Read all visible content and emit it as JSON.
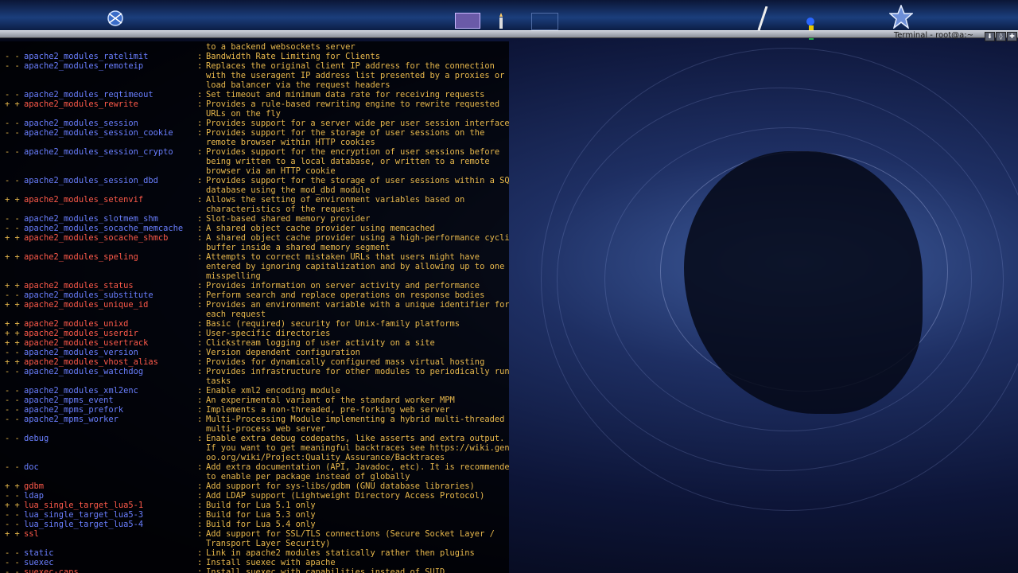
{
  "desktop": {
    "terminal_title": "Terminal - root@a:~",
    "window_buttons": [
      "⬇",
      "◊",
      "✚"
    ]
  },
  "terminal": {
    "lines": [
      {
        "flags": "",
        "pkg": "",
        "state": "",
        "colon": "",
        "desc": "to a backend websockets server"
      },
      {
        "flags": "- -",
        "pkg": "apache2_modules_ratelimit",
        "state": "off",
        "colon": ":",
        "desc": "Bandwidth Rate Limiting for Clients"
      },
      {
        "flags": "- -",
        "pkg": "apache2_modules_remoteip",
        "state": "off",
        "colon": ":",
        "desc": "Replaces the original client IP address for the connection"
      },
      {
        "flags": "",
        "pkg": "",
        "state": "",
        "colon": "",
        "desc": "with the useragent IP address list presented by a proxies or a"
      },
      {
        "flags": "",
        "pkg": "",
        "state": "",
        "colon": "",
        "desc": "load balancer via the request headers"
      },
      {
        "flags": "- -",
        "pkg": "apache2_modules_reqtimeout",
        "state": "off",
        "colon": ":",
        "desc": "Set timeout and minimum data rate for receiving requests"
      },
      {
        "flags": "+ +",
        "pkg": "apache2_modules_rewrite",
        "state": "on",
        "colon": ":",
        "desc": "Provides a rule-based rewriting engine to rewrite requested"
      },
      {
        "flags": "",
        "pkg": "",
        "state": "",
        "colon": "",
        "desc": "URLs on the fly"
      },
      {
        "flags": "- -",
        "pkg": "apache2_modules_session",
        "state": "off",
        "colon": ":",
        "desc": "Provides support for a server wide per user session interface"
      },
      {
        "flags": "- -",
        "pkg": "apache2_modules_session_cookie",
        "state": "off",
        "colon": ":",
        "desc": "Provides support for the storage of user sessions on the"
      },
      {
        "flags": "",
        "pkg": "",
        "state": "",
        "colon": "",
        "desc": "remote browser within HTTP cookies"
      },
      {
        "flags": "- -",
        "pkg": "apache2_modules_session_crypto",
        "state": "off",
        "colon": ":",
        "desc": "Provides support for the encryption of user sessions before"
      },
      {
        "flags": "",
        "pkg": "",
        "state": "",
        "colon": "",
        "desc": "being written to a local database, or written to a remote"
      },
      {
        "flags": "",
        "pkg": "",
        "state": "",
        "colon": "",
        "desc": "browser via an HTTP cookie"
      },
      {
        "flags": "- -",
        "pkg": "apache2_modules_session_dbd",
        "state": "off",
        "colon": ":",
        "desc": "Provides support for the storage of user sessions within a SQL"
      },
      {
        "flags": "",
        "pkg": "",
        "state": "",
        "colon": "",
        "desc": "database using the mod_dbd module"
      },
      {
        "flags": "+ +",
        "pkg": "apache2_modules_setenvif",
        "state": "on",
        "colon": ":",
        "desc": "Allows the setting of environment variables based on"
      },
      {
        "flags": "",
        "pkg": "",
        "state": "",
        "colon": "",
        "desc": "characteristics of the request"
      },
      {
        "flags": "- -",
        "pkg": "apache2_modules_slotmem_shm",
        "state": "off",
        "colon": ":",
        "desc": "Slot-based shared memory provider"
      },
      {
        "flags": "- -",
        "pkg": "apache2_modules_socache_memcache",
        "state": "off",
        "colon": ":",
        "desc": "A shared object cache provider using memcached"
      },
      {
        "flags": "+ +",
        "pkg": "apache2_modules_socache_shmcb",
        "state": "on",
        "colon": ":",
        "desc": "A shared object cache provider using a high-performance cyclic"
      },
      {
        "flags": "",
        "pkg": "",
        "state": "",
        "colon": "",
        "desc": "buffer inside a shared memory segment"
      },
      {
        "flags": "+ +",
        "pkg": "apache2_modules_speling",
        "state": "on",
        "colon": ":",
        "desc": "Attempts to correct mistaken URLs that users might have"
      },
      {
        "flags": "",
        "pkg": "",
        "state": "",
        "colon": "",
        "desc": "entered by ignoring capitalization and by allowing up to one"
      },
      {
        "flags": "",
        "pkg": "",
        "state": "",
        "colon": "",
        "desc": "misspelling"
      },
      {
        "flags": "+ +",
        "pkg": "apache2_modules_status",
        "state": "on",
        "colon": ":",
        "desc": "Provides information on server activity and performance"
      },
      {
        "flags": "- -",
        "pkg": "apache2_modules_substitute",
        "state": "off",
        "colon": ":",
        "desc": "Perform search and replace operations on response bodies"
      },
      {
        "flags": "+ +",
        "pkg": "apache2_modules_unique_id",
        "state": "on",
        "colon": ":",
        "desc": "Provides an environment variable with a unique identifier for"
      },
      {
        "flags": "",
        "pkg": "",
        "state": "",
        "colon": "",
        "desc": "each request"
      },
      {
        "flags": "+ +",
        "pkg": "apache2_modules_unixd",
        "state": "on",
        "colon": ":",
        "desc": "Basic (required) security for Unix-family platforms"
      },
      {
        "flags": "+ +",
        "pkg": "apache2_modules_userdir",
        "state": "on",
        "colon": ":",
        "desc": "User-specific directories"
      },
      {
        "flags": "+ +",
        "pkg": "apache2_modules_usertrack",
        "state": "on",
        "colon": ":",
        "desc": "Clickstream logging of user activity on a site"
      },
      {
        "flags": "- -",
        "pkg": "apache2_modules_version",
        "state": "off",
        "colon": ":",
        "desc": "Version dependent configuration"
      },
      {
        "flags": "+ +",
        "pkg": "apache2_modules_vhost_alias",
        "state": "on",
        "colon": ":",
        "desc": "Provides for dynamically configured mass virtual hosting"
      },
      {
        "flags": "- -",
        "pkg": "apache2_modules_watchdog",
        "state": "off",
        "colon": ":",
        "desc": "Provides infrastructure for other modules to periodically run"
      },
      {
        "flags": "",
        "pkg": "",
        "state": "",
        "colon": "",
        "desc": "tasks"
      },
      {
        "flags": "- -",
        "pkg": "apache2_modules_xml2enc",
        "state": "off",
        "colon": ":",
        "desc": "Enable xml2 encoding module"
      },
      {
        "flags": "- -",
        "pkg": "apache2_mpms_event",
        "state": "off",
        "colon": ":",
        "desc": "An experimental variant of the standard worker MPM"
      },
      {
        "flags": "- -",
        "pkg": "apache2_mpms_prefork",
        "state": "off",
        "colon": ":",
        "desc": "Implements a non-threaded, pre-forking web server"
      },
      {
        "flags": "- -",
        "pkg": "apache2_mpms_worker",
        "state": "off",
        "colon": ":",
        "desc": "Multi-Processing Module implementing a hybrid multi-threaded"
      },
      {
        "flags": "",
        "pkg": "",
        "state": "",
        "colon": "",
        "desc": "multi-process web server"
      },
      {
        "flags": "- -",
        "pkg": "debug",
        "state": "off",
        "colon": ":",
        "desc": "Enable extra debug codepaths, like asserts and extra output."
      },
      {
        "flags": "",
        "pkg": "",
        "state": "",
        "colon": "",
        "desc": "If you want to get meaningful backtraces see https://wiki.gent"
      },
      {
        "flags": "",
        "pkg": "",
        "state": "",
        "colon": "",
        "desc": "oo.org/wiki/Project:Quality_Assurance/Backtraces"
      },
      {
        "flags": "- -",
        "pkg": "doc",
        "state": "off",
        "colon": ":",
        "desc": "Add extra documentation (API, Javadoc, etc). It is recommended"
      },
      {
        "flags": "",
        "pkg": "",
        "state": "",
        "colon": "",
        "desc": "to enable per package instead of globally"
      },
      {
        "flags": "+ +",
        "pkg": "gdbm",
        "state": "on",
        "colon": ":",
        "desc": "Add support for sys-libs/gdbm (GNU database libraries)"
      },
      {
        "flags": "- -",
        "pkg": "ldap",
        "state": "off",
        "colon": ":",
        "desc": "Add LDAP support (Lightweight Directory Access Protocol)"
      },
      {
        "flags": "+ +",
        "pkg": "lua_single_target_lua5-1",
        "state": "on",
        "colon": ":",
        "desc": "Build for Lua 5.1 only"
      },
      {
        "flags": "- -",
        "pkg": "lua_single_target_lua5-3",
        "state": "off",
        "colon": ":",
        "desc": "Build for Lua 5.3 only"
      },
      {
        "flags": "- -",
        "pkg": "lua_single_target_lua5-4",
        "state": "off",
        "colon": ":",
        "desc": "Build for Lua 5.4 only"
      },
      {
        "flags": "+ +",
        "pkg": "ssl",
        "state": "on",
        "colon": ":",
        "desc": "Add support for SSL/TLS connections (Secure Socket Layer /"
      },
      {
        "flags": "",
        "pkg": "",
        "state": "",
        "colon": "",
        "desc": "Transport Layer Security)"
      },
      {
        "flags": "- -",
        "pkg": "static",
        "state": "off",
        "colon": ":",
        "desc": "Link in apache2 modules statically rather then plugins"
      },
      {
        "flags": "- -",
        "pkg": "suexec",
        "state": "off",
        "colon": ":",
        "desc": "Install suexec with apache"
      },
      {
        "flags": "- -",
        "pkg": "suexec-caps",
        "state": "on",
        "colon": ":",
        "desc": "Install suexec with capabilities instead of SUID"
      }
    ]
  }
}
